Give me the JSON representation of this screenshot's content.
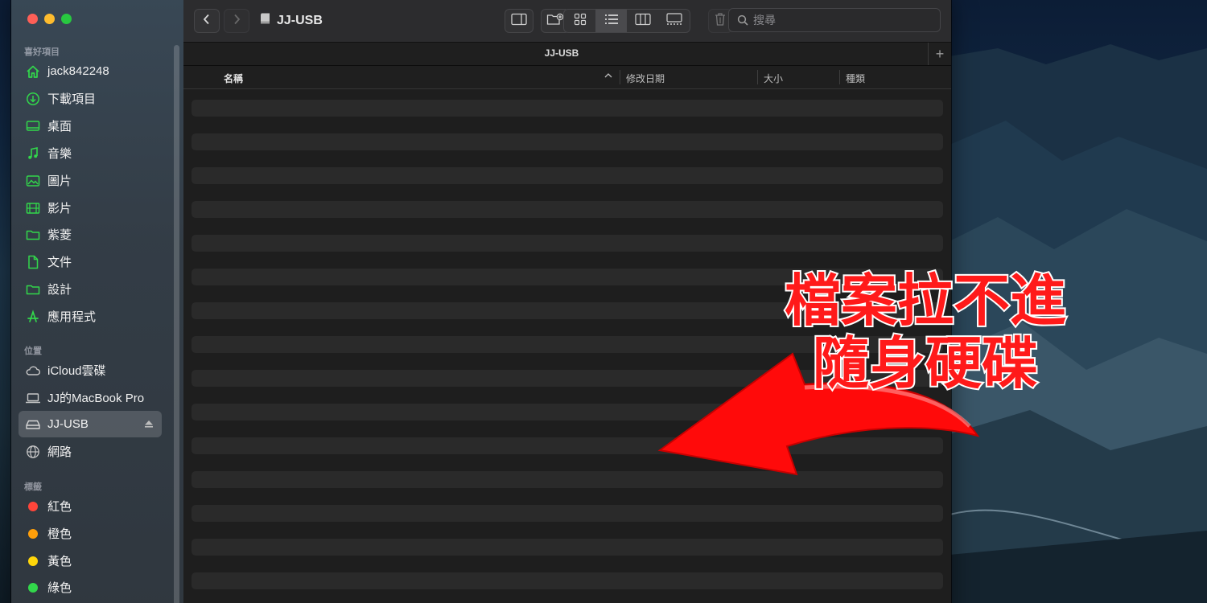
{
  "window": {
    "title": "JJ-USB",
    "tab_title": "JJ-USB",
    "tab_add": "+"
  },
  "toolbar": {
    "back_icon": "chevron-left-icon",
    "forward_icon": "chevron-right-icon",
    "search_placeholder": "搜尋"
  },
  "sidebar": {
    "favorites_title": "喜好項目",
    "favorites": [
      {
        "label": "jack842248",
        "icon": "home-icon"
      },
      {
        "label": "下載項目",
        "icon": "download-icon"
      },
      {
        "label": "桌面",
        "icon": "desktop-icon"
      },
      {
        "label": "音樂",
        "icon": "music-icon"
      },
      {
        "label": "圖片",
        "icon": "photo-icon"
      },
      {
        "label": "影片",
        "icon": "film-icon"
      },
      {
        "label": "紫菱",
        "icon": "folder-icon"
      },
      {
        "label": "文件",
        "icon": "document-icon"
      },
      {
        "label": "設計",
        "icon": "folder-icon"
      },
      {
        "label": "應用程式",
        "icon": "apps-icon"
      }
    ],
    "locations_title": "位置",
    "locations": [
      {
        "label": "iCloud雲碟",
        "icon": "cloud-icon"
      },
      {
        "label": "JJ的MacBook Pro",
        "icon": "laptop-icon"
      },
      {
        "label": "JJ-USB",
        "icon": "drive-icon",
        "selected": true
      },
      {
        "label": "網路",
        "icon": "globe-icon"
      }
    ],
    "tags_title": "標籤",
    "tags": [
      {
        "label": "紅色",
        "color": "#ff453a"
      },
      {
        "label": "橙色",
        "color": "#ff9f0a"
      },
      {
        "label": "黃色",
        "color": "#ffd60a"
      },
      {
        "label": "綠色",
        "color": "#32d74b"
      }
    ]
  },
  "columns": {
    "name": "名稱",
    "modified": "修改日期",
    "size": "大小",
    "kind": "種類"
  },
  "annotation": {
    "line1": "檔案拉不進",
    "line2": "隨身硬碟",
    "color": "#ff1a1a"
  },
  "colors": {
    "accent_green": "#32d74b",
    "window_bg": "#1e1e1e",
    "sidebar_bg": "#3a4754"
  }
}
